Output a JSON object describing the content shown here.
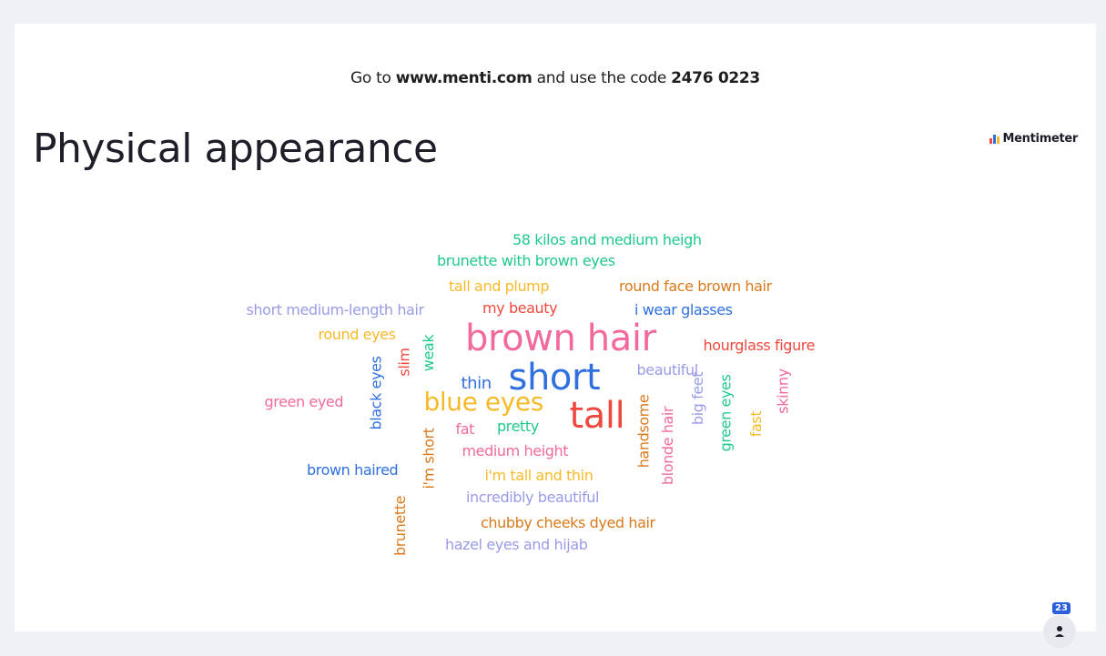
{
  "join": {
    "prefix": "Go to ",
    "url": "www.menti.com",
    "middle": " and use the code ",
    "code": "2476 0223"
  },
  "title": "Physical appearance",
  "brand": {
    "name": "Mentimeter",
    "icon": "mentimeter-logo-icon"
  },
  "participants": {
    "count": "23",
    "icon": "person-icon"
  },
  "colors": {
    "green": "#1fc98a",
    "yellow": "#f6b928",
    "orange": "#d9791a",
    "pink": "#f26a9d",
    "red": "#f0483e",
    "blue": "#2f6fe0",
    "lavender": "#9a9be8"
  },
  "words": [
    {
      "text": "58 kilos and medium heigh",
      "color": "green",
      "weight": 16
    },
    {
      "text": "brunette with brown eyes",
      "color": "green",
      "weight": 16
    },
    {
      "text": "tall and plump",
      "color": "yellow",
      "weight": 16
    },
    {
      "text": "round face brown hair",
      "color": "orange",
      "weight": 16
    },
    {
      "text": "short medium-length hair",
      "color": "lavender",
      "weight": 16
    },
    {
      "text": "my beauty",
      "color": "red",
      "weight": 16
    },
    {
      "text": "i wear glasses",
      "color": "blue",
      "weight": 16
    },
    {
      "text": "round eyes",
      "color": "yellow",
      "weight": 16
    },
    {
      "text": "brown hair",
      "color": "pink",
      "weight": 40
    },
    {
      "text": "hourglass figure",
      "color": "red",
      "weight": 16
    },
    {
      "text": "slim",
      "color": "red",
      "weight": 16
    },
    {
      "text": "weak",
      "color": "green",
      "weight": 16
    },
    {
      "text": "beautiful",
      "color": "lavender",
      "weight": 16
    },
    {
      "text": "thin",
      "color": "blue",
      "weight": 18
    },
    {
      "text": "short",
      "color": "blue",
      "weight": 40
    },
    {
      "text": "black eyes",
      "color": "blue",
      "weight": 16
    },
    {
      "text": "green eyed",
      "color": "pink",
      "weight": 16
    },
    {
      "text": "blue eyes",
      "color": "yellow",
      "weight": 28
    },
    {
      "text": "tall",
      "color": "red",
      "weight": 40
    },
    {
      "text": "skinny",
      "color": "pink",
      "weight": 16
    },
    {
      "text": "big feet",
      "color": "lavender",
      "weight": 16
    },
    {
      "text": "green eyes",
      "color": "green",
      "weight": 16
    },
    {
      "text": "handsome",
      "color": "orange",
      "weight": 16
    },
    {
      "text": "fat",
      "color": "pink",
      "weight": 16
    },
    {
      "text": "pretty",
      "color": "green",
      "weight": 16
    },
    {
      "text": "blonde hair",
      "color": "pink",
      "weight": 16
    },
    {
      "text": "fast",
      "color": "yellow",
      "weight": 16
    },
    {
      "text": "i'm short",
      "color": "orange",
      "weight": 16
    },
    {
      "text": "medium height",
      "color": "pink",
      "weight": 16
    },
    {
      "text": "brown haired",
      "color": "blue",
      "weight": 16
    },
    {
      "text": "i'm tall and thin",
      "color": "yellow",
      "weight": 16
    },
    {
      "text": "incredibly beautiful",
      "color": "lavender",
      "weight": 16
    },
    {
      "text": "brunette",
      "color": "orange",
      "weight": 16
    },
    {
      "text": "chubby cheeks dyed hair",
      "color": "orange",
      "weight": 16
    },
    {
      "text": "hazel eyes and hijab",
      "color": "lavender",
      "weight": 16
    }
  ]
}
